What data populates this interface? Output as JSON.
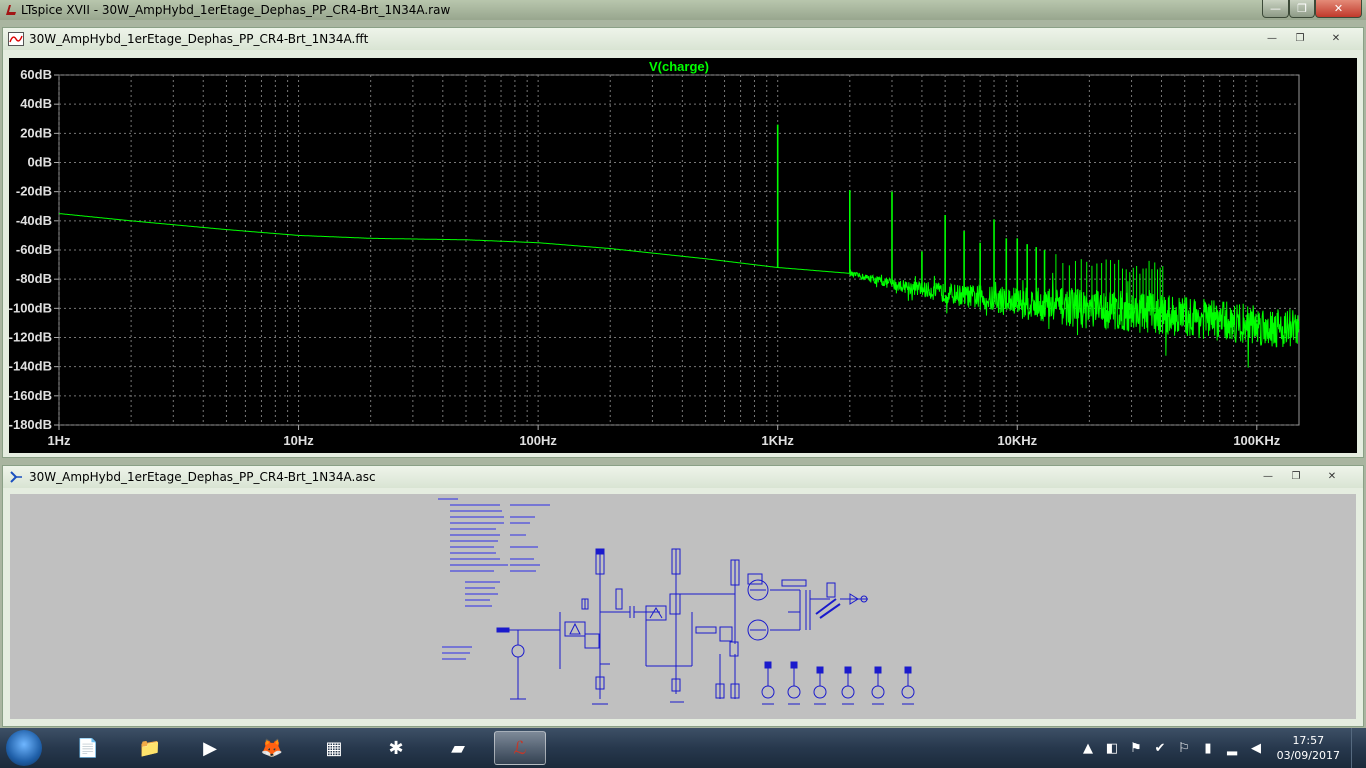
{
  "app": {
    "title": "LTspice XVII - 30W_AmpHybd_1erEtage_Dephas_PP_CR4-Brt_1N34A.raw"
  },
  "window_controls": {
    "minimize": "—",
    "restore": "❐",
    "close": "✕"
  },
  "waveform_window": {
    "title": "30W_AmpHybd_1erEtage_Dephas_PP_CR4-Brt_1N34A.fft",
    "trace_name": "V(charge)",
    "trace_color": "#00ff00",
    "icon": "waveform-icon"
  },
  "schematic_window": {
    "title": "30W_AmpHybd_1erEtage_Dephas_PP_CR4-Brt_1N34A.asc",
    "icon": "schematic-icon",
    "wire_color": "#1a1acc"
  },
  "chart_data": {
    "type": "line",
    "title": "V(charge)",
    "x_scale": "log",
    "xlim": [
      1,
      150000
    ],
    "ylim": [
      -180,
      60
    ],
    "y_ticks": [
      "60dB",
      "40dB",
      "20dB",
      "0dB",
      "-20dB",
      "-40dB",
      "-60dB",
      "-80dB",
      "-100dB",
      "-120dB",
      "-140dB",
      "-160dB",
      "-180dB"
    ],
    "x_ticks": [
      "1Hz",
      "10Hz",
      "100Hz",
      "1KHz",
      "10KHz",
      "100KHz"
    ],
    "grid": true,
    "series": [
      {
        "name": "V(charge)",
        "baseline_x": [
          1,
          2,
          5,
          10,
          20,
          50,
          100,
          200,
          500,
          1000,
          2000,
          3000,
          5000,
          10000,
          20000,
          50000,
          100000,
          150000
        ],
        "baseline_y": [
          -35,
          -40,
          -46,
          -50,
          -52,
          -53,
          -55,
          -59,
          -66,
          -72,
          -76,
          -83,
          -89,
          -95,
          -99,
          -104,
          -110,
          -113
        ],
        "harmonics_x": [
          1000,
          2000,
          3000,
          4000,
          5000,
          6000,
          7000,
          8000,
          9000,
          10000,
          11000,
          12000,
          13000
        ],
        "harmonics_y": [
          26,
          -19,
          -20,
          -61,
          -36,
          -47,
          -55,
          -39,
          -52,
          -52,
          -56,
          -58,
          -60
        ]
      }
    ]
  },
  "taskbar": {
    "apps": [
      {
        "name": "file-explorer-doc",
        "glyph": "📄"
      },
      {
        "name": "windows-explorer",
        "glyph": "📁"
      },
      {
        "name": "media-player",
        "glyph": "▶"
      },
      {
        "name": "firefox",
        "glyph": "🦊"
      },
      {
        "name": "calculator",
        "glyph": "▦"
      },
      {
        "name": "navigator",
        "glyph": "✱"
      },
      {
        "name": "notebook",
        "glyph": "▰"
      },
      {
        "name": "ltspice",
        "glyph": "ℒ"
      }
    ],
    "tray": {
      "time": "17:57",
      "date": "03/09/2017"
    }
  }
}
